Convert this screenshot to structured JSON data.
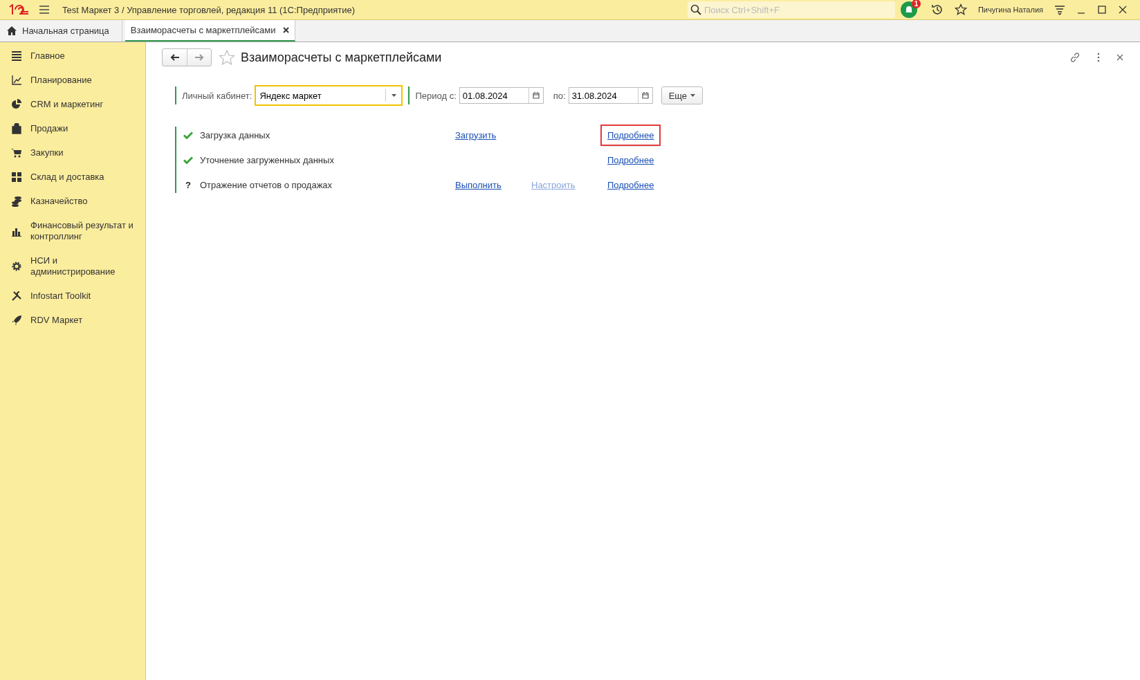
{
  "window": {
    "title": "Test Маркет 3 / Управление торговлей, редакция 11  (1С:Предприятие)"
  },
  "search": {
    "placeholder": "Поиск Ctrl+Shift+F"
  },
  "notifications": {
    "count": "1"
  },
  "user": {
    "name": "Пичугина Наталия"
  },
  "tabs": [
    {
      "label": "Начальная страница",
      "kind": "home",
      "selected": false
    },
    {
      "label": "Взаиморасчеты с маркетплейсами",
      "kind": "doc",
      "selected": true
    }
  ],
  "sidebar": {
    "items": [
      {
        "label": "Главное"
      },
      {
        "label": "Планирование"
      },
      {
        "label": "CRM и маркетинг"
      },
      {
        "label": "Продажи"
      },
      {
        "label": "Закупки"
      },
      {
        "label": "Склад и доставка"
      },
      {
        "label": "Казначейство"
      },
      {
        "label": "Финансовый результат и контроллинг"
      },
      {
        "label": "НСИ и администрирование"
      },
      {
        "label": "Infostart Toolkit"
      },
      {
        "label": "RDV Маркет"
      }
    ]
  },
  "form": {
    "title": "Взаиморасчеты с маркетплейсами",
    "account": {
      "label": "Личный кабинет:",
      "value": "Яндекс маркет"
    },
    "period": {
      "from_label": "Период с:",
      "from": "01.08.2024",
      "to_label": "по:",
      "to": "31.08.2024"
    },
    "more_button": "Еще",
    "steps": [
      {
        "kind": "done",
        "label": "Загрузка данных",
        "action": {
          "label": "Загрузить",
          "disabled": false
        },
        "details": {
          "label": "Подробнее",
          "highlighted": true
        }
      },
      {
        "kind": "done",
        "label": "Уточнение загруженных данных",
        "details": {
          "label": "Подробнее",
          "highlighted": false
        }
      },
      {
        "kind": "question",
        "status_symbol": "?",
        "label": "Отражение отчетов о продажах",
        "action": {
          "label": "Выполнить",
          "disabled": false
        },
        "setup": {
          "label": "Настроить",
          "disabled": true
        },
        "details": {
          "label": "Подробнее",
          "highlighted": false
        }
      }
    ]
  }
}
